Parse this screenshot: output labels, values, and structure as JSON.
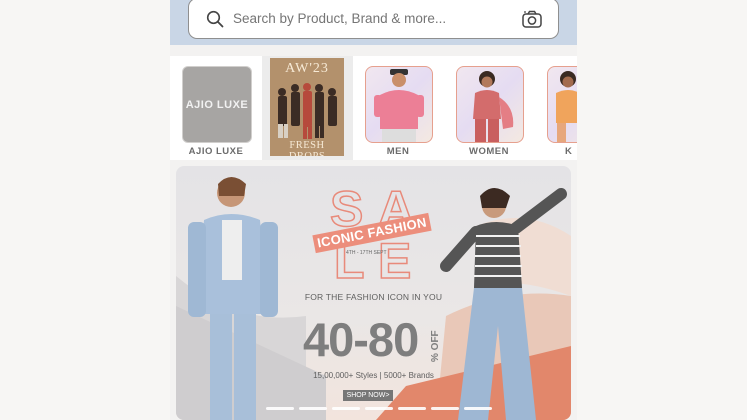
{
  "search": {
    "placeholder": "Search by Product, Brand & more..."
  },
  "categories": [
    {
      "label": "AJIO LUXE",
      "tile_text": "AJIO LUXE"
    },
    {
      "label": "",
      "tile_text_top": "AW'23",
      "tile_text_bottom": "FRESH DROPS"
    },
    {
      "label": "MEN"
    },
    {
      "label": "WOMEN"
    },
    {
      "label": "K"
    }
  ],
  "banner": {
    "sale_letters": [
      "S",
      "A",
      "L",
      "E"
    ],
    "badge": "ICONIC FASHION",
    "dates": "4TH - 17TH SEPT",
    "tagline": "FOR THE FASHION ICON IN YOU",
    "discount": "40-80",
    "discount_suffix": "% OFF",
    "styles_line": "15,00,000+ Styles | 5000+ Brands",
    "cta": "SHOP NOW>",
    "carousel_dot_count": 7
  },
  "colors": {
    "accent": "#ec8e7c",
    "header_strip": "#c9d6e6",
    "muted_text": "#7e7e7e"
  }
}
